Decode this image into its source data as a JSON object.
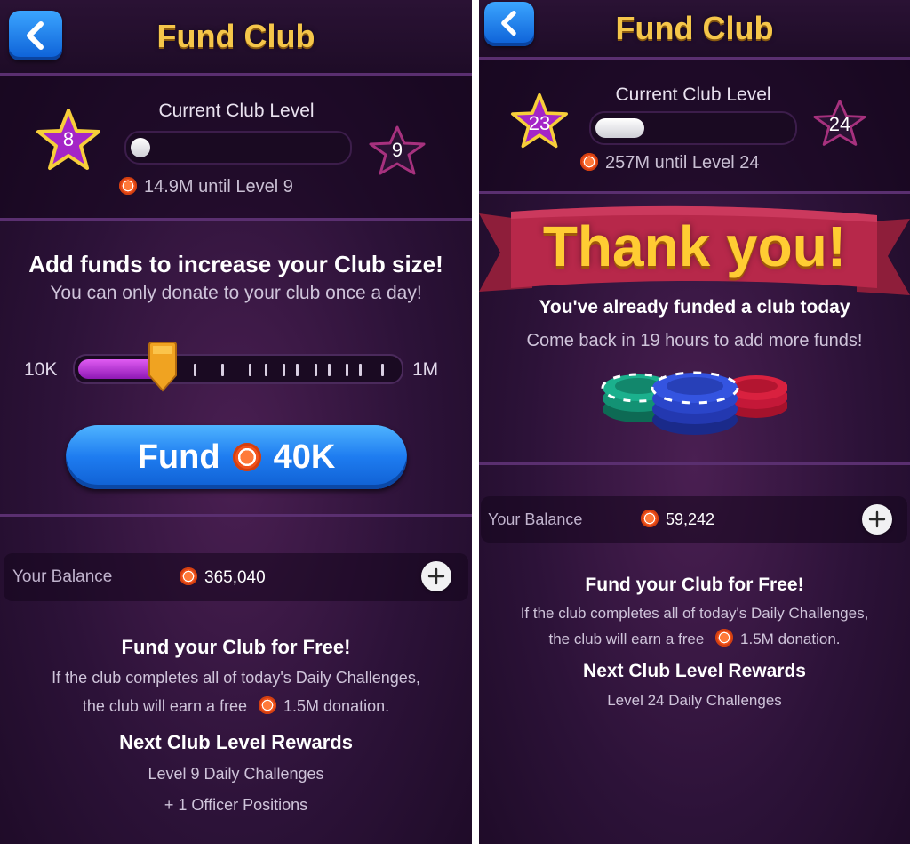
{
  "left": {
    "title": "Fund Club",
    "level_label": "Current Club Level",
    "current_level": "8",
    "next_level": "9",
    "level_progress": 0.05,
    "until_text": "14.9M until Level 9",
    "add_funds_title": "Add funds to increase your Club size!",
    "add_funds_subtitle": "You can only donate to your club once a day!",
    "slider_min": "10K",
    "slider_max": "1M",
    "slider_value": 0.27,
    "fund_button_label": "Fund",
    "fund_button_amount": "40K",
    "balance_label": "Your Balance",
    "balance_value": "365,040",
    "free_title": "Fund your Club for Free!",
    "free_line1": "If the club completes all of today's Daily Challenges,",
    "free_line2_prefix": "the club will earn a free",
    "free_line2_suffix": "1.5M donation.",
    "rewards_title": "Next Club Level Rewards",
    "reward1": "Level 9 Daily Challenges",
    "reward2": "+ 1 Officer Positions"
  },
  "right": {
    "title": "Fund Club",
    "level_label": "Current Club Level",
    "current_level": "23",
    "next_level": "24",
    "level_progress": 0.25,
    "until_text": "257M until Level 24",
    "thank_you": "Thank you!",
    "already_funded": "You've already funded a club today",
    "come_back": "Come back in 19 hours to add more funds!",
    "balance_label": "Your Balance",
    "balance_value": "59,242",
    "free_title": "Fund your Club for Free!",
    "free_line1": "If the club completes all of today's Daily Challenges,",
    "free_line2_prefix": "the club will earn a free",
    "free_line2_suffix": "1.5M donation.",
    "rewards_title": "Next Club Level Rewards",
    "reward1": "Level 24 Daily Challenges"
  },
  "icons": {
    "back": "chevron-left-icon",
    "star": "star-icon",
    "chip": "poker-chip-icon",
    "plus": "plus-icon"
  },
  "colors": {
    "gold_title": "#f5c64a",
    "blue_button": "#1e7cf0",
    "purple_fill": "#b52fd6",
    "chip_orange": "#f1521c"
  }
}
